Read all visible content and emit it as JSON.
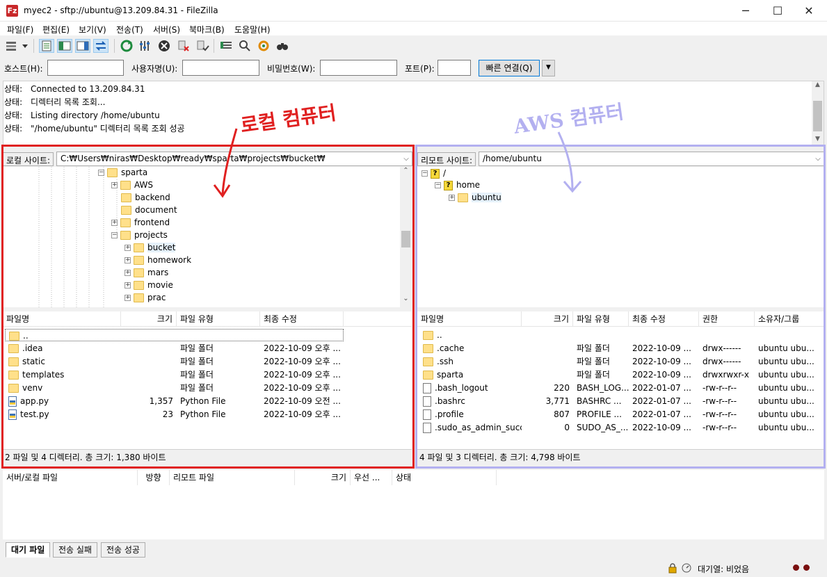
{
  "window": {
    "title": "myec2 - sftp://ubuntu@13.209.84.31 - FileZilla",
    "app_icon": "Fz",
    "minimize": "─",
    "maximize": "☐",
    "close": "✕"
  },
  "menu": [
    "파일(F)",
    "편집(E)",
    "보기(V)",
    "전송(T)",
    "서버(S)",
    "북마크(B)",
    "도움말(H)"
  ],
  "quickconnect": {
    "host_label": "호스트(H):",
    "user_label": "사용자명(U):",
    "pass_label": "비밀번호(W):",
    "port_label": "포트(P):",
    "host_value": "",
    "user_value": "",
    "pass_value": "",
    "port_value": "",
    "button": "빠른 연결(Q)"
  },
  "log": [
    {
      "key": "상태:",
      "text": "Connected to 13.209.84.31"
    },
    {
      "key": "상태:",
      "text": "디렉터리 목록 조회..."
    },
    {
      "key": "상태:",
      "text": "Listing directory /home/ubuntu"
    },
    {
      "key": "상태:",
      "text": "\"/home/ubuntu\" 디렉터리 목록 조회 성공"
    }
  ],
  "local": {
    "site_label": "로컬 사이트:",
    "path": "C:₩Users₩niras₩Desktop₩ready₩sparta₩projects₩bucket₩",
    "tree": [
      "sparta",
      "AWS",
      "backend",
      "document",
      "frontend",
      "projects",
      "bucket",
      "homework",
      "mars",
      "movie",
      "prac"
    ],
    "columns": [
      "파일명",
      "크기",
      "파일 유형",
      "최종 수정"
    ],
    "files": [
      {
        "name": "..",
        "size": "",
        "type": "",
        "modified": ""
      },
      {
        "name": ".idea",
        "size": "",
        "type": "파일 폴더",
        "modified": "2022-10-09 오후 ..."
      },
      {
        "name": "static",
        "size": "",
        "type": "파일 폴더",
        "modified": "2022-10-09 오후 ..."
      },
      {
        "name": "templates",
        "size": "",
        "type": "파일 폴더",
        "modified": "2022-10-09 오후 ..."
      },
      {
        "name": "venv",
        "size": "",
        "type": "파일 폴더",
        "modified": "2022-10-09 오후 ..."
      },
      {
        "name": "app.py",
        "size": "1,357",
        "type": "Python File",
        "modified": "2022-10-09 오전 ..."
      },
      {
        "name": "test.py",
        "size": "23",
        "type": "Python File",
        "modified": "2022-10-09 오후 ..."
      }
    ],
    "status": "2 파일 및 4 디렉터리. 총 크기: 1,380 바이트"
  },
  "remote": {
    "site_label": "리모트 사이트:",
    "path": "/home/ubuntu",
    "tree": [
      "/",
      "home",
      "ubuntu"
    ],
    "columns": [
      "파일명",
      "크기",
      "파일 유형",
      "최종 수정",
      "권한",
      "소유자/그룹"
    ],
    "files": [
      {
        "name": "..",
        "size": "",
        "type": "",
        "modified": "",
        "perm": "",
        "owner": ""
      },
      {
        "name": ".cache",
        "size": "",
        "type": "파일 폴더",
        "modified": "2022-10-09 ...",
        "perm": "drwx------",
        "owner": "ubuntu ubu..."
      },
      {
        "name": ".ssh",
        "size": "",
        "type": "파일 폴더",
        "modified": "2022-10-09 ...",
        "perm": "drwx------",
        "owner": "ubuntu ubu..."
      },
      {
        "name": "sparta",
        "size": "",
        "type": "파일 폴더",
        "modified": "2022-10-09 ...",
        "perm": "drwxrwxr-x",
        "owner": "ubuntu ubu..."
      },
      {
        "name": ".bash_logout",
        "size": "220",
        "type": "BASH_LOG...",
        "modified": "2022-01-07 ...",
        "perm": "-rw-r--r--",
        "owner": "ubuntu ubu..."
      },
      {
        "name": ".bashrc",
        "size": "3,771",
        "type": "BASHRC ...",
        "modified": "2022-01-07 ...",
        "perm": "-rw-r--r--",
        "owner": "ubuntu ubu..."
      },
      {
        "name": ".profile",
        "size": "807",
        "type": "PROFILE ...",
        "modified": "2022-01-07 ...",
        "perm": "-rw-r--r--",
        "owner": "ubuntu ubu..."
      },
      {
        "name": ".sudo_as_admin_succ...",
        "size": "0",
        "type": "SUDO_AS_...",
        "modified": "2022-10-09 ...",
        "perm": "-rw-r--r--",
        "owner": "ubuntu ubu..."
      }
    ],
    "status": "4 파일 및 3 디렉터리. 총 크기: 4,798 바이트"
  },
  "queue": {
    "columns": [
      "서버/로컬 파일",
      "방향",
      "리모트 파일",
      "크기",
      "우선 ...",
      "상태"
    ],
    "tabs": [
      "대기 파일",
      "전송 실패",
      "전송 성공"
    ]
  },
  "statusbar": {
    "queue": "대기열: 비었음"
  },
  "annotations": {
    "local": "로컬 컴퓨터",
    "remote": "AWS 컴퓨터",
    "local_color": "#e02020",
    "remote_color": "#b3b0f0"
  }
}
